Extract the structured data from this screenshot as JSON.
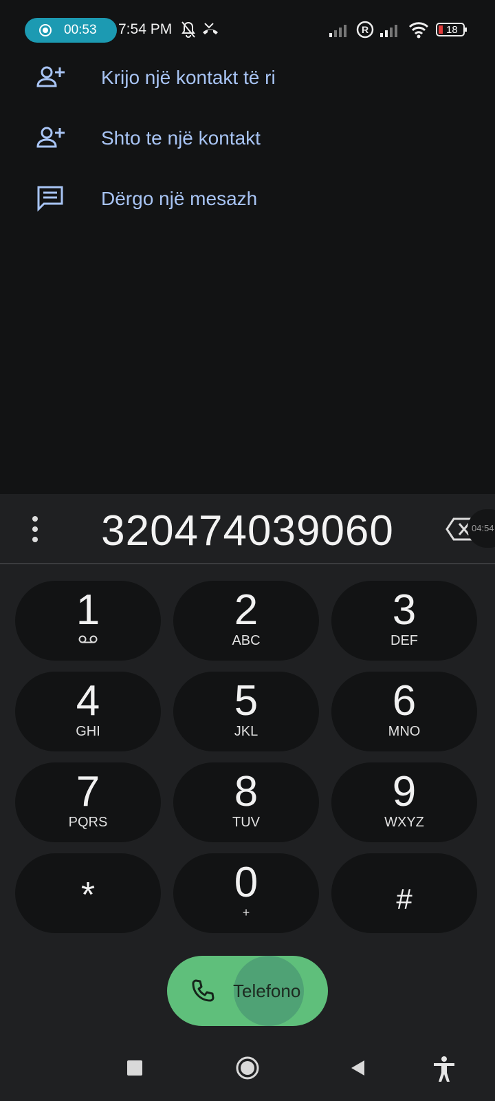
{
  "status_bar": {
    "recording_timer": "00:53",
    "time": "7:54 PM",
    "battery_level": "18"
  },
  "menu": {
    "items": [
      {
        "label": "Krijo një kontakt të ri",
        "icon": "person-add-icon"
      },
      {
        "label": "Shto te një kontakt",
        "icon": "person-add-icon"
      },
      {
        "label": "Dërgo një mesazh",
        "icon": "message-icon"
      }
    ]
  },
  "dialer": {
    "number": "320474039060",
    "call_timer_chip": "04:54",
    "keys": [
      {
        "digit": "1",
        "letters": ""
      },
      {
        "digit": "2",
        "letters": "ABC"
      },
      {
        "digit": "3",
        "letters": "DEF"
      },
      {
        "digit": "4",
        "letters": "GHI"
      },
      {
        "digit": "5",
        "letters": "JKL"
      },
      {
        "digit": "6",
        "letters": "MNO"
      },
      {
        "digit": "7",
        "letters": "PQRS"
      },
      {
        "digit": "8",
        "letters": "TUV"
      },
      {
        "digit": "9",
        "letters": "WXYZ"
      },
      {
        "digit": "*",
        "letters": ""
      },
      {
        "digit": "0",
        "letters": "+"
      },
      {
        "digit": "#",
        "letters": ""
      }
    ],
    "call_label": "Telefono"
  },
  "colors": {
    "background": "#121314",
    "keypad_background": "#1f2022",
    "accent_text": "#a8c4f4",
    "call_button": "#5fbf7b",
    "recording_pill": "#1c9ab2"
  }
}
